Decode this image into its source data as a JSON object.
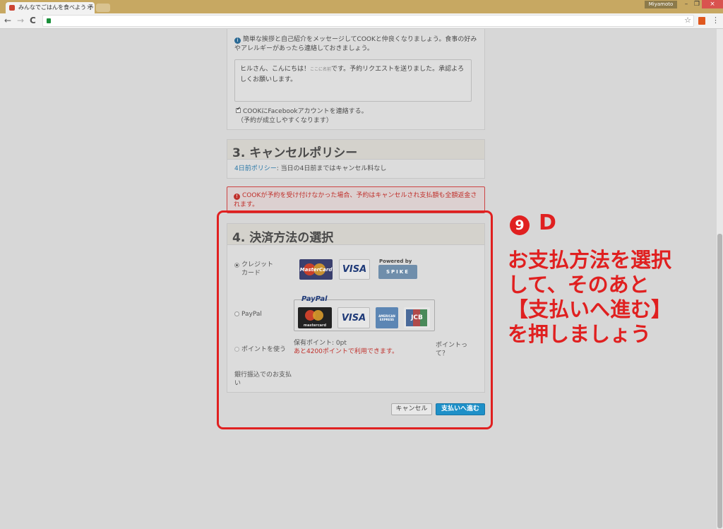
{
  "browser": {
    "tab_title": "みんなでごはんを食べよう 予",
    "tab_close": "×",
    "user_name": "Miyamoto",
    "min_label": "–",
    "max_label": "❐",
    "close_label": "×",
    "back_glyph": "←",
    "forward_glyph": "→",
    "reload_glyph": "C",
    "star_glyph": "☆",
    "menu_glyph": "⋮"
  },
  "message_section": {
    "info_text": "簡単な挨拶と自己紹介をメッセージしてCOOKと仲良くなりましょう。食事の好みやアレルギーがあったら連絡しておきましょう。",
    "message_value_1": "ヒルさん、こんにちは！",
    "message_small": "ここに名前",
    "message_value_2": "です。予約リクエストを送りました。承認よろしくお願いします。",
    "facebook_label": "COOKにFacebookアカウントを連絡する。",
    "facebook_note": "（予約が成立しやすくなります）"
  },
  "cancel_section": {
    "title": "3. キャンセルポリシー",
    "policy_link": "4日前ポリシー",
    "policy_text": ": 当日の4日前まではキャンセル料なし"
  },
  "error_text": "COOKが予約を受け付けなかった場合、予約はキャンセルされ支払額も全額返金されます。",
  "payment_section": {
    "title": "4. 決済方法の選択",
    "credit_label": "クレジットカード",
    "paypal_label": "PayPal",
    "points_label": "ポイントを使う",
    "points_balance": "保有ポイント: 0pt",
    "points_needed": "あと4200ポイントで利用できます。",
    "points_link": "ポイントって？",
    "bank_link": "銀行振込でのお支払い",
    "powered_by": "Powered by",
    "spike": "SPIKE",
    "paypal_brand": "PayPal",
    "mastercard": "MasterCard",
    "mastercard_small": "mastercard",
    "visa": "VISA",
    "amex": "AMERICAN EXPRESS",
    "jcb": "JCB",
    "cancel_button": "キャンセル",
    "submit_button": "支払いへ進む"
  },
  "annotation": {
    "step_number": "9",
    "step_letter": "D",
    "line1": "お支払方法を選択",
    "line2": "して、そのあと",
    "line3": "【支払いへ進む】",
    "line4": "を押しましょう"
  },
  "colors": {
    "accent": "#1e90c8",
    "annotation": "#e02020",
    "error": "#c0302b"
  }
}
